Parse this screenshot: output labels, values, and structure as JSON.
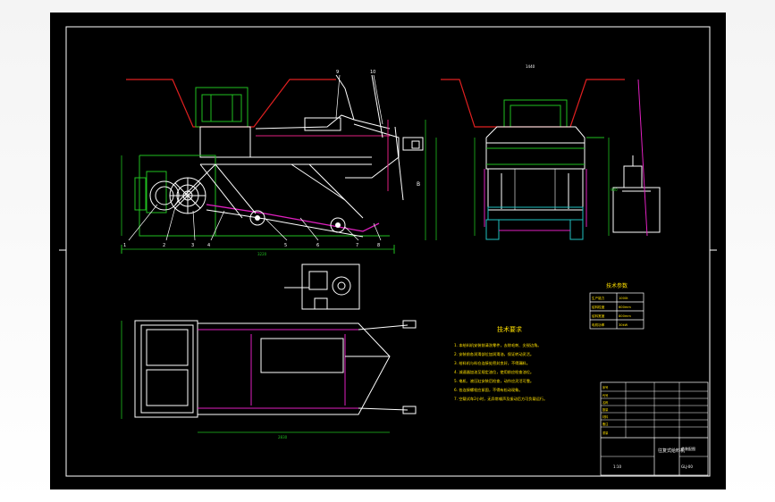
{
  "drawing": {
    "tech_requirements_title": "技术要求",
    "tech_params_title": "技术参数",
    "tech_requirements": [
      "1. 本给料机安装前清洗零件，去除毛刺、尖锐边角。",
      "2. 安装前各润滑部位加润滑油，保证转动灵活。",
      "3. 给料机与料仓连接处密封良好，不得漏料。",
      "4. 减速器加油至规定油位，使用前应检查油位。",
      "5. 电机、液压缸安装后检查，动作应灵活可靠。",
      "6. 各连接螺栓应紧固，不得有松动现象。",
      "7. 空载试车2小时，无异常噪声及振动后方可负载运行。"
    ],
    "tech_params": [
      [
        "生产能力",
        "1000t"
      ],
      [
        "给料粒度",
        "600mm"
      ],
      [
        "给料宽度",
        "800mm"
      ],
      [
        "电机功率",
        "30kW"
      ]
    ],
    "title_block_name": "往复式给料机",
    "title_block_sub": "总装配图",
    "title_block_number": "GLJ-00",
    "title_block_scale": "1:10",
    "title_block_rows": [
      "序号",
      "代号",
      "名称",
      "数量",
      "材料",
      "备注",
      "重量"
    ],
    "dimension_labels": {
      "top_width_right": "1440",
      "top_width_left": "1560",
      "bottom_length": "3220",
      "plan_length": "2830",
      "plan_width": "1180",
      "height_right": "980",
      "height_left": "860",
      "label_b": "B"
    },
    "part_numbers": [
      "1",
      "2",
      "3",
      "4",
      "5",
      "6",
      "7",
      "8",
      "9",
      "10",
      "11",
      "12"
    ]
  }
}
